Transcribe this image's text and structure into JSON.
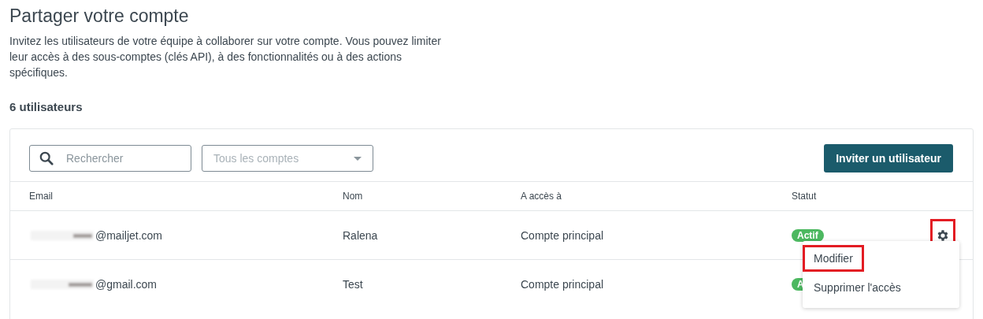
{
  "title": "Partager votre compte",
  "description": "Invitez les utilisateurs de votre équipe à collaborer sur votre compte. Vous pouvez limiter leur accès à des sous-comptes (clés API), à des fonctionnalités ou à des actions spécifiques.",
  "user_count": "6 utilisateurs",
  "search": {
    "placeholder": "Rechercher"
  },
  "account_filter": {
    "placeholder": "Tous les comptes"
  },
  "invite_button": "Inviter un utilisateur",
  "table": {
    "columns": [
      "Email",
      "Nom",
      "A accès à",
      "Statut"
    ],
    "rows": [
      {
        "email": "@mailjet.com",
        "name": "Ralena",
        "access": "Compte principal",
        "status": "Actif",
        "gear": {
          "highlighted": true
        }
      },
      {
        "email": "@gmail.com",
        "name": "Test",
        "access": "Compte principal",
        "status": "A"
      }
    ]
  },
  "menu": {
    "items": [
      {
        "label": "Modifier",
        "highlighted": true
      },
      {
        "label": "Supprimer l'accès",
        "highlighted": false
      }
    ]
  }
}
